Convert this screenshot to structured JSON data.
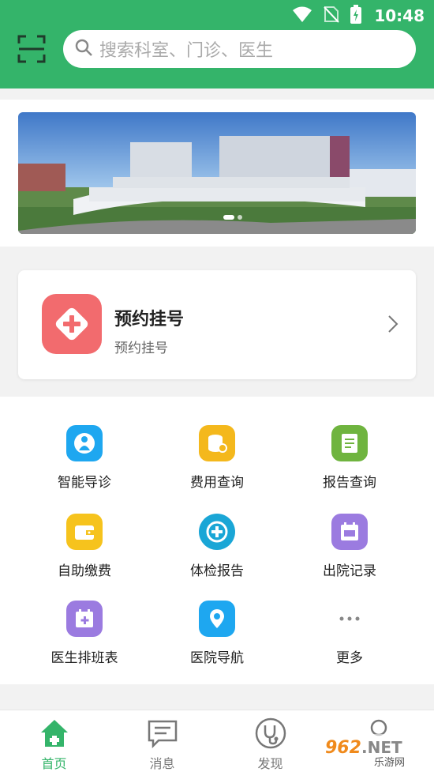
{
  "status_bar": {
    "time": "10:48"
  },
  "search": {
    "placeholder": "搜索科室、门诊、医生"
  },
  "appointment": {
    "title": "预约挂号",
    "subtitle": "预约挂号"
  },
  "grid": [
    {
      "label": "智能导诊",
      "icon": "smart-guide-icon",
      "color": "#1ea7f0"
    },
    {
      "label": "费用查询",
      "icon": "fee-query-icon",
      "color": "#f4b81c"
    },
    {
      "label": "报告查询",
      "icon": "report-query-icon",
      "color": "#6fb43f"
    },
    {
      "label": "自助缴费",
      "icon": "wallet-icon",
      "color": "#f6c31d"
    },
    {
      "label": "体检报告",
      "icon": "checkup-report-icon",
      "color": "#1aa6d6"
    },
    {
      "label": "出院记录",
      "icon": "discharge-record-icon",
      "color": "#9b7be0"
    },
    {
      "label": "医生排班表",
      "icon": "doctor-schedule-icon",
      "color": "#9b7be0"
    },
    {
      "label": "医院导航",
      "icon": "location-pin-icon",
      "color": "#1ea7f0"
    },
    {
      "label": "更多",
      "icon": "more-icon",
      "color": "#888888"
    }
  ],
  "bottom_nav": [
    {
      "label": "首页",
      "icon": "home-icon",
      "active": true
    },
    {
      "label": "消息",
      "icon": "message-icon",
      "active": false
    },
    {
      "label": "发现",
      "icon": "stethoscope-icon",
      "active": false
    },
    {
      "label": "",
      "icon": "user-icon",
      "active": false
    }
  ],
  "watermark": {
    "text": "962.NET",
    "subtext": "乐游网"
  },
  "colors": {
    "primary": "#34b46a",
    "appointment_red": "#f26b6e"
  }
}
